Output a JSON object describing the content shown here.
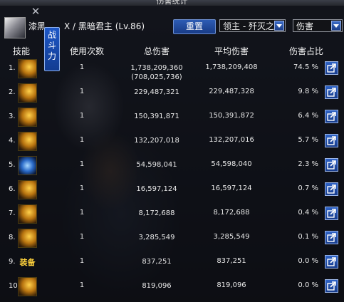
{
  "window": {
    "title": "伤害统计"
  },
  "character": {
    "name": "漆黑",
    "suffix": "X / 黑暗君主 (Lv.86)"
  },
  "controls": {
    "reset_label": "重置",
    "target_select": "领主 - 歼灭之",
    "mode_select": "伤害",
    "side_tab": "战斗力"
  },
  "headers": {
    "skill": "技能",
    "count": "使用次数",
    "total": "总伤害",
    "avg": "平均伤害",
    "share": "伤害占比"
  },
  "rows": [
    {
      "idx": "1.",
      "icon": "flame-skill-icon",
      "count": "1",
      "total": "1,738,209,360",
      "total_sub": "(708,025,736)",
      "avg": "1,738,209,408",
      "pct": "74.5 %"
    },
    {
      "idx": "2.",
      "icon": "dark-slash-skill-icon",
      "count": "1",
      "total": "229,487,321",
      "total_sub": "",
      "avg": "229,487,328",
      "pct": "9.8 %"
    },
    {
      "idx": "3.",
      "icon": "dark-slash-skill-icon",
      "count": "1",
      "total": "150,391,871",
      "total_sub": "",
      "avg": "150,391,872",
      "pct": "6.4 %"
    },
    {
      "idx": "4.",
      "icon": "dark-slash-skill-icon",
      "count": "1",
      "total": "132,207,018",
      "total_sub": "",
      "avg": "132,207,016",
      "pct": "5.7 %"
    },
    {
      "idx": "5.",
      "icon": "blue-aura-skill-icon",
      "count": "1",
      "total": "54,598,041",
      "total_sub": "",
      "avg": "54,598,040",
      "pct": "2.3 %"
    },
    {
      "idx": "6.",
      "icon": "dark-orb-skill-icon",
      "count": "1",
      "total": "16,597,124",
      "total_sub": "",
      "avg": "16,597,124",
      "pct": "0.7 %"
    },
    {
      "idx": "7.",
      "icon": "rune-circle-skill-icon",
      "count": "1",
      "total": "8,172,688",
      "total_sub": "",
      "avg": "8,172,688",
      "pct": "0.4 %"
    },
    {
      "idx": "8.",
      "icon": "rune-circle-skill-icon",
      "count": "1",
      "total": "3,285,549",
      "total_sub": "",
      "avg": "3,285,549",
      "pct": "0.1 %"
    },
    {
      "idx": "9.",
      "icon": "equipment-label",
      "icon_text": "装备",
      "count": "1",
      "total": "837,251",
      "total_sub": "",
      "avg": "837,251",
      "pct": "0.0 %"
    },
    {
      "idx": "10.",
      "icon": "dark-slash-skill-icon",
      "count": "1",
      "total": "819,096",
      "total_sub": "",
      "avg": "819,096",
      "pct": "0.0 %"
    }
  ]
}
